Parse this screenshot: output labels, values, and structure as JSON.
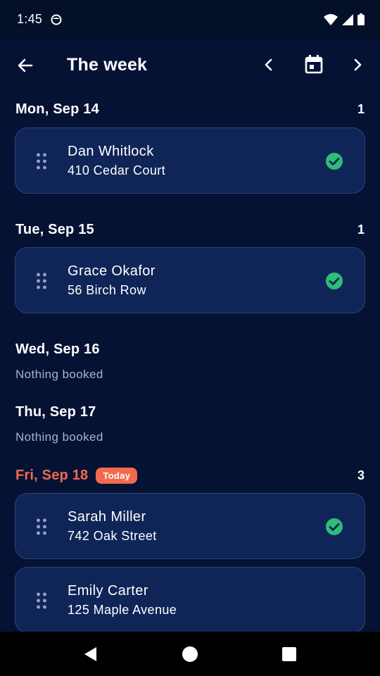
{
  "status_bar": {
    "time": "1:45"
  },
  "app_bar": {
    "title": "The week"
  },
  "days": [
    {
      "label": "Mon, Sep 14",
      "count": "1",
      "appointments": [
        {
          "name": "Dan Whitlock",
          "address": "410 Cedar Court",
          "confirmed": true
        }
      ]
    },
    {
      "label": "Tue, Sep 15",
      "count": "1",
      "appointments": [
        {
          "name": "Grace Okafor",
          "address": "56 Birch Row",
          "confirmed": true
        }
      ]
    },
    {
      "label": "Wed, Sep 16",
      "empty_text": "Nothing booked"
    },
    {
      "label": "Thu, Sep 17",
      "empty_text": "Nothing booked"
    },
    {
      "label": "Fri, Sep 18",
      "badge": "Today",
      "count": "3",
      "appointments": [
        {
          "name": "Sarah Miller",
          "address": "742 Oak Street",
          "confirmed": true
        },
        {
          "name": "Emily Carter",
          "address": "125 Maple Avenue",
          "confirmed": false
        }
      ]
    }
  ],
  "colors": {
    "background": "#051234",
    "card": "#0f2557",
    "today_accent": "#f26a4b",
    "confirmed_check": "#2ebd76"
  },
  "icons": {
    "back": "arrow-left-icon",
    "prev": "chevron-left-icon",
    "calendar": "calendar-icon",
    "next": "chevron-right-icon",
    "drag": "drag-handle-icon",
    "check": "check-circle-icon"
  }
}
